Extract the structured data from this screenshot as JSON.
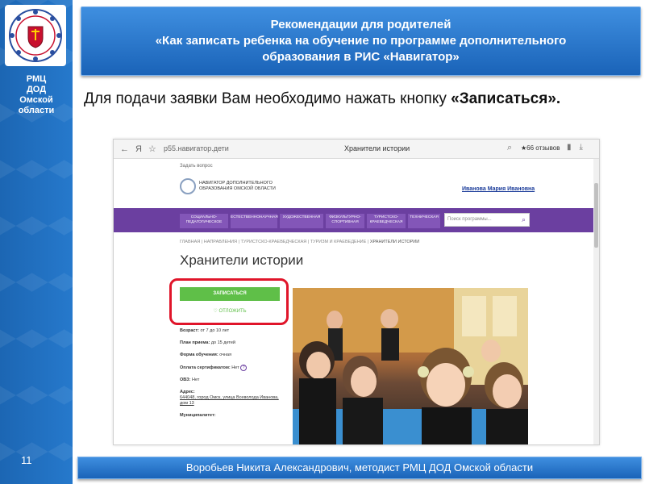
{
  "slide": {
    "org_label_lines": [
      "РМЦ",
      "ДОД",
      "Омской",
      "области"
    ],
    "slide_number": "11",
    "title_lines": [
      "Рекомендации для родителей",
      "«Как записать ребенка на обучение по программе дополнительного",
      "образования в РИС «Навигатор»"
    ],
    "instruction_text": "Для подачи заявки Вам необходимо нажать кнопку ",
    "instruction_bold": "«Записаться».",
    "footer_text": "Воробьев Никита Александрович, методист РМЦ ДОД Омской области"
  },
  "browser": {
    "url": "р55.навигатор.дети",
    "tab_title": "Хранители истории",
    "reviews": "★66 отзывов",
    "ask_question": "Задать вопрос",
    "site_name": "НАВИГАТОР ДОПОЛНИТЕЛЬНОГО ОБРАЗОВАНИЯ ОМСКОЙ ОБЛАСТИ",
    "user_name": "Иванова Мария Ивановна",
    "nav_items": [
      "СОЦИАЛЬНО-ПЕДАГОГИЧЕСКОЕ",
      "ЕСТЕСТВЕННОНАУЧНАЯ",
      "ХУДОЖЕСТВЕННАЯ",
      "ФИЗКУЛЬТУРНО-СПОРТИВНАЯ",
      "ТУРИСТСКО-КРАЕВЕДЧЕСКАЯ",
      "ТЕХНИЧЕСКАЯ"
    ],
    "search_placeholder": "Поиск программы...",
    "breadcrumbs": [
      "ГЛАВНАЯ",
      "НАПРАВЛЕНИЯ",
      "ТУРИСТСКО-КРАЕВЕДЧЕСКАЯ",
      "ТУРИЗМ И КРАЕВЕДЕНИЕ"
    ],
    "breadcrumb_current": "ХРАНИТЕЛИ ИСТОРИИ",
    "page_heading": "Хранители истории",
    "enroll_button": "ЗАПИСАТЬСЯ",
    "defer_button": "ОТЛОЖИТЬ",
    "info": {
      "age_label": "Возраст:",
      "age_value": "от 7 до 10 лет",
      "plan_label": "План приема:",
      "plan_value": "до 15 детей",
      "form_label": "Форма обучения:",
      "form_value": "очная",
      "cert_label": "Оплата сертификатом:",
      "cert_value": "Нет",
      "ovz_label": "ОВЗ:",
      "ovz_value": "Нет",
      "address_label": "Адрес:",
      "address_value": "644048, город Омск, улица Всеволода Иванова, дом 13",
      "municipality_label": "Муниципалитет:"
    }
  },
  "colors": {
    "banner": "#1a63b8",
    "sidebar": "#1f6fc0",
    "site_nav": "#6b3fa0",
    "enroll": "#5fbf48",
    "highlight": "#e0152a"
  }
}
